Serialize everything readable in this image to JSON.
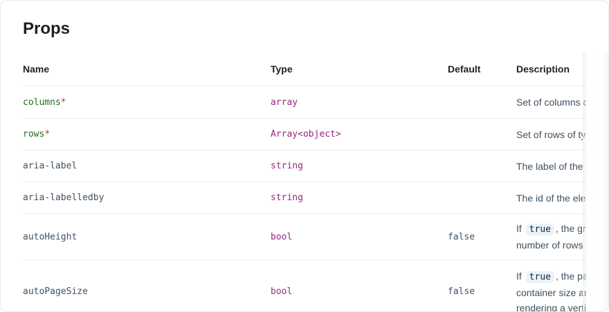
{
  "page": {
    "title": "Props"
  },
  "table": {
    "headers": {
      "name": "Name",
      "type": "Type",
      "default": "Default",
      "description": "Description"
    },
    "rows": [
      {
        "name": "columns",
        "required": "*",
        "type": "array",
        "default": "",
        "desc_lines": [
          "Set of columns o"
        ]
      },
      {
        "name": "rows",
        "required": "*",
        "type": "Array<object>",
        "default": "",
        "desc_lines": [
          "Set of rows of ty"
        ]
      },
      {
        "name": "aria-label",
        "required": "",
        "type": "string",
        "default": "",
        "desc_lines": [
          "The label of the"
        ]
      },
      {
        "name": "aria-labelledby",
        "required": "",
        "type": "string",
        "default": "",
        "desc_lines": [
          "The id of the ele"
        ]
      },
      {
        "name": "autoHeight",
        "required": "",
        "type": "bool",
        "default": "false",
        "desc_prefix": "If",
        "desc_code": "true",
        "desc_suffix": ", the gri",
        "desc_line2": "number of rows",
        "desc_line3": ""
      },
      {
        "name": "autoPageSize",
        "required": "",
        "type": "bool",
        "default": "false",
        "desc_prefix": "If",
        "desc_code": "true",
        "desc_suffix": ", the pa",
        "desc_line2": "container size ar",
        "desc_line3": "rendering a verti"
      }
    ]
  }
}
